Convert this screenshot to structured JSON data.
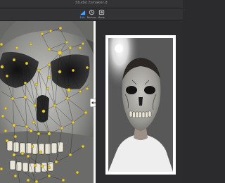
{
  "window": {
    "title": "Studio.fxmaker.d"
  },
  "toolbar": {
    "tools": [
      {
        "label": "Edit",
        "icon": "edit-icon",
        "active": true
      },
      {
        "label": "Review",
        "icon": "review-icon",
        "active": false
      },
      {
        "label": "Mode",
        "icon": "mode-icon",
        "active": false
      }
    ]
  },
  "colors": {
    "accent": "#4aa3ff",
    "landmark": "#e8cc3a",
    "divider": "#f2f2f2"
  },
  "workspace": {
    "split_handle_icon": "split-arrows-icon",
    "left_view": "face-mesh-texture-editor",
    "right_view": "camera-preview"
  }
}
